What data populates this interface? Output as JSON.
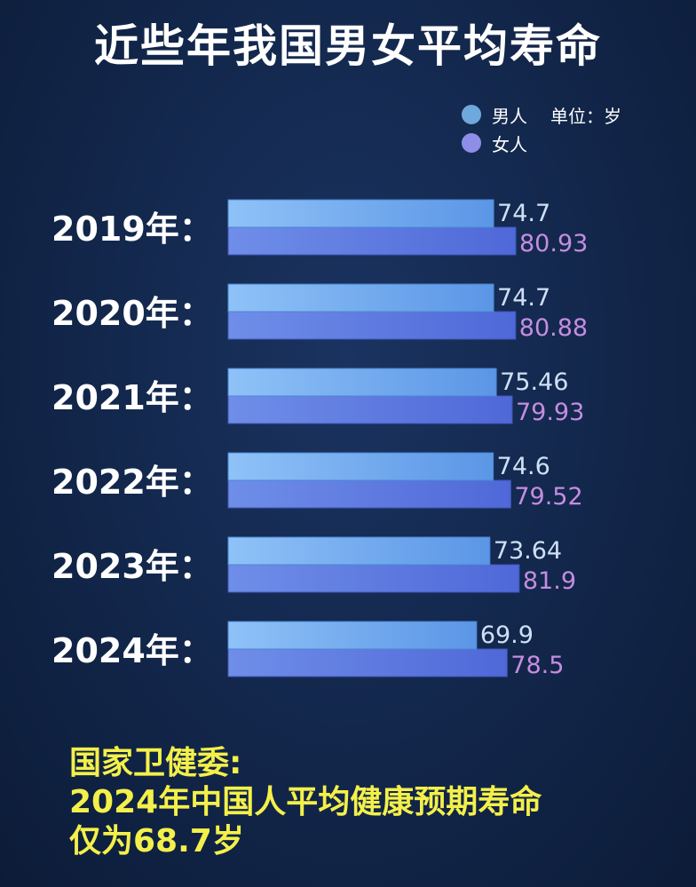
{
  "title": "近些年我国男女平均寿命",
  "legend": {
    "male_label": "男人",
    "female_label": "女人",
    "unit_label": "单位：岁"
  },
  "chart_data": {
    "type": "bar",
    "orientation": "horizontal",
    "categories": [
      "2019年：",
      "2020年：",
      "2021年：",
      "2022年：",
      "2023年：",
      "2024年："
    ],
    "series": [
      {
        "name": "男人",
        "values": [
          74.7,
          74.7,
          75.46,
          74.6,
          73.64,
          69.9
        ],
        "labels": [
          "74.7",
          "74.7",
          "75.46",
          "74.6",
          "73.64",
          "69.9"
        ]
      },
      {
        "name": "女人",
        "values": [
          80.93,
          80.88,
          79.93,
          79.52,
          81.9,
          78.5
        ],
        "labels": [
          "80.93",
          "80.88",
          "79.93",
          "79.52",
          "81.9",
          "78.5"
        ]
      }
    ],
    "unit": "岁",
    "legend_position": "top-right",
    "grid": false
  },
  "footnote": {
    "line1": "国家卫健委:",
    "line2": "2024年中国人平均健康预期寿命",
    "line3": "仅为68.7岁"
  },
  "colors": {
    "background": "#12264a",
    "male_bar": "#6aa6ee",
    "female_bar": "#5d78e0",
    "male_dot": "#6fa8dc",
    "female_dot": "#8e8ee6",
    "male_value_text": "#cfe0f5",
    "female_value_text": "#c58de0",
    "footnote_text": "#f4f04a"
  }
}
